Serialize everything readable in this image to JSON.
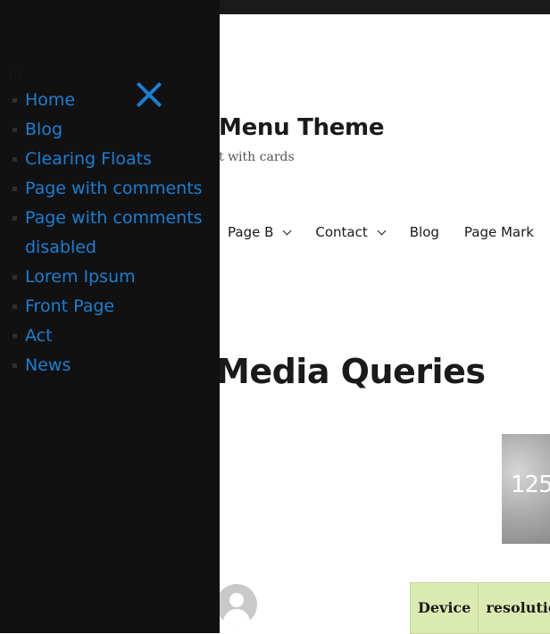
{
  "site": {
    "title": "Menu Theme",
    "description": "t with cards"
  },
  "main_nav": {
    "items": [
      {
        "label": "Page B",
        "has_submenu": true
      },
      {
        "label": "Contact",
        "has_submenu": true
      },
      {
        "label": "Blog",
        "has_submenu": false
      },
      {
        "label": "Page Mark",
        "has_submenu": false
      }
    ]
  },
  "entry": {
    "title": "Media Queries",
    "image_text": "125"
  },
  "table": {
    "headers": [
      "Device",
      "resolutio"
    ]
  },
  "drawer": {
    "close_icon": "close-icon",
    "dots": ": :",
    "items": [
      "Home",
      "Blog",
      "Clearing Floats",
      "Page with comments",
      "Page with comments disabled",
      "Lorem Ipsum",
      "Front Page",
      "Act",
      "News"
    ]
  },
  "colors": {
    "accent": "#1a7fd4",
    "drawer_bg": "#111111",
    "topbar_bg": "#1a1a1a",
    "table_header_bg": "#dbeab0"
  }
}
